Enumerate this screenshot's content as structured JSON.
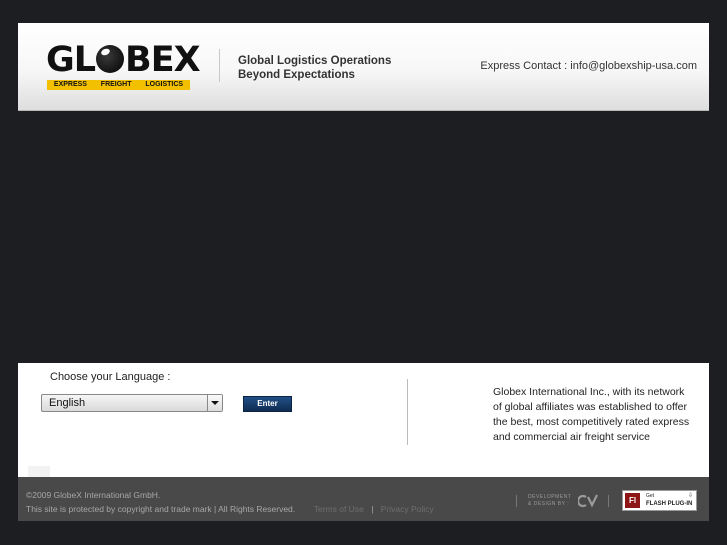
{
  "header": {
    "logo": {
      "name": "GLOBEX",
      "band": [
        "EXPRESS",
        "FREIGHT",
        "LOGISTICS"
      ],
      "band_color": "#f2c000"
    },
    "tagline_line1": "Global Logistics Operations",
    "tagline_line2": "Beyond Expectations",
    "contact": "Express Contact : info@globexship-usa.com"
  },
  "language": {
    "label": "Choose your Language :",
    "selected": "English",
    "enter_label": "Enter"
  },
  "about_text": "Globex International Inc., with its network of global affiliates was established to offer the best, most competitively rated express and commercial air freight service",
  "footer": {
    "copyright": "©2009 GlobeX International GmbH.",
    "rights": "This site is protected by copyright and trade mark | All Rights Reserved.",
    "terms_label": "Terms of Use",
    "separator": "|",
    "privacy_label": "Privacy Policy",
    "dev_line1": "DEVELOPMENT",
    "dev_line2": "& DESIGN BY :",
    "flash_get": "Get",
    "flash_name": "FLASH PLUG-IN",
    "flash_icon": "Fl"
  },
  "colors": {
    "background": "#1d1e21",
    "enter_button": "#1a3f6e",
    "footer": "#494949",
    "flash_icon": "#8e1515"
  }
}
